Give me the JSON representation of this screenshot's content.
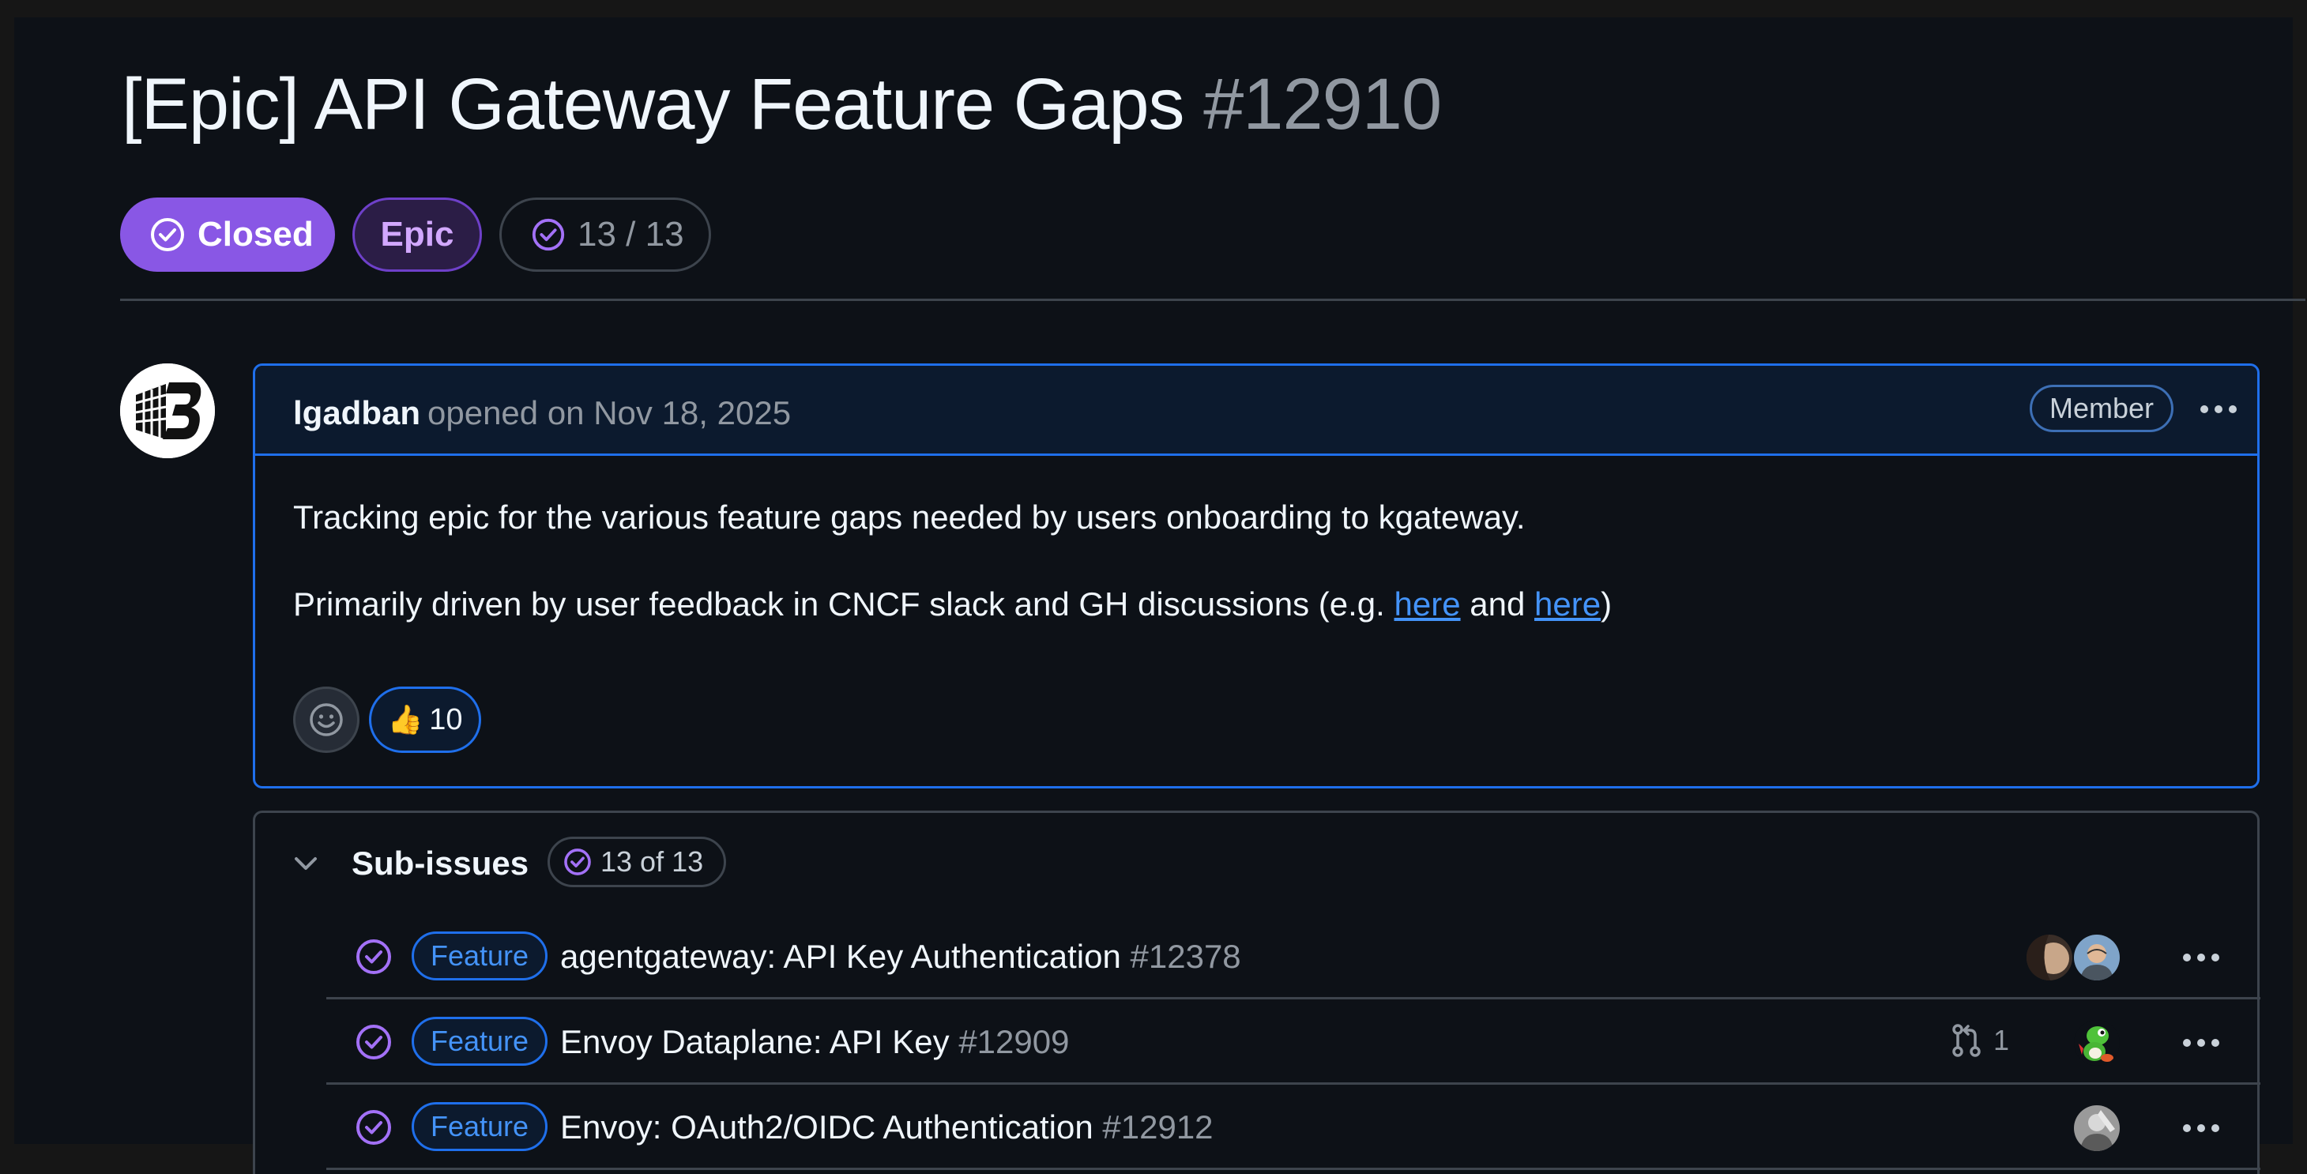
{
  "issue": {
    "title": "[Epic] API Gateway Feature Gaps",
    "number": "#12910",
    "state_label": "Closed",
    "type_label": "Epic",
    "progress": "13 / 13"
  },
  "comment": {
    "author": "lgadban",
    "opened_text": "opened on Nov 18, 2025",
    "role_badge": "Member",
    "line1": "Tracking epic for the various feature gaps needed by users onboarding to kgateway.",
    "line2_prefix": "Primarily driven by user feedback in CNCF slack and GH discussions (e.g.",
    "link1": "here",
    "and_text": "and",
    "link2": "here",
    "line2_suffix": ")",
    "reaction_emoji": "👍",
    "reaction_count": "10"
  },
  "sub_issues": {
    "title": "Sub-issues",
    "count": "13 of 13",
    "items": [
      {
        "label": "Feature",
        "title": "agentgateway: API Key Authentication",
        "number": "#12378"
      },
      {
        "label": "Feature",
        "title": "Envoy Dataplane: API Key",
        "number": "#12909",
        "linked_prs": "1"
      },
      {
        "label": "Feature",
        "title": "Envoy: OAuth2/OIDC Authentication",
        "number": "#12912"
      }
    ]
  },
  "colors": {
    "accent_purple": "#8957e5",
    "link_blue": "#4493f8",
    "background": "#0d1117"
  }
}
